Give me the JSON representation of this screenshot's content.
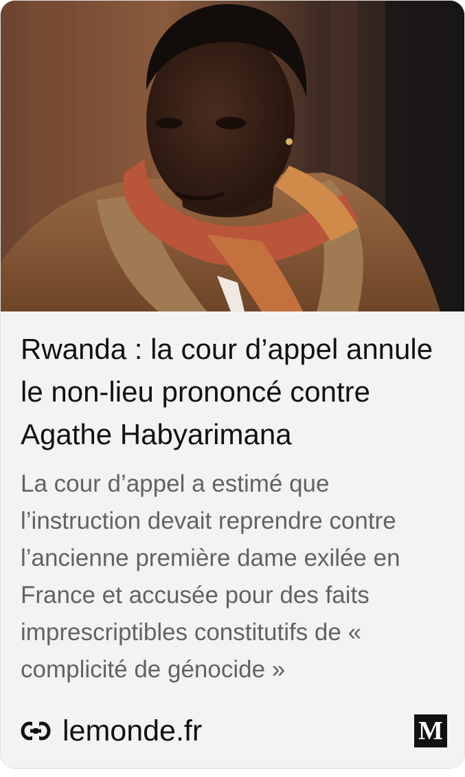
{
  "card": {
    "image_alt": "Portrait d'une femme portant une écharpe rouge et orange",
    "headline": "Rwanda : la cour d’appel annule le non-lieu prononcé contre Agathe Habyarimana",
    "description": "La cour d’appel a estimé que l’instruction devait reprendre contre l’ancienne première dame exilée en France et accusée pour des faits imprescriptibles constitutifs de « complicité de génocide »",
    "domain": "lemonde.fr",
    "link_icon": "link-icon",
    "publisher_logo_text": "M"
  },
  "colors": {
    "card_background": "#f5f3f2",
    "headline": "#111111",
    "description": "#5f6368"
  }
}
